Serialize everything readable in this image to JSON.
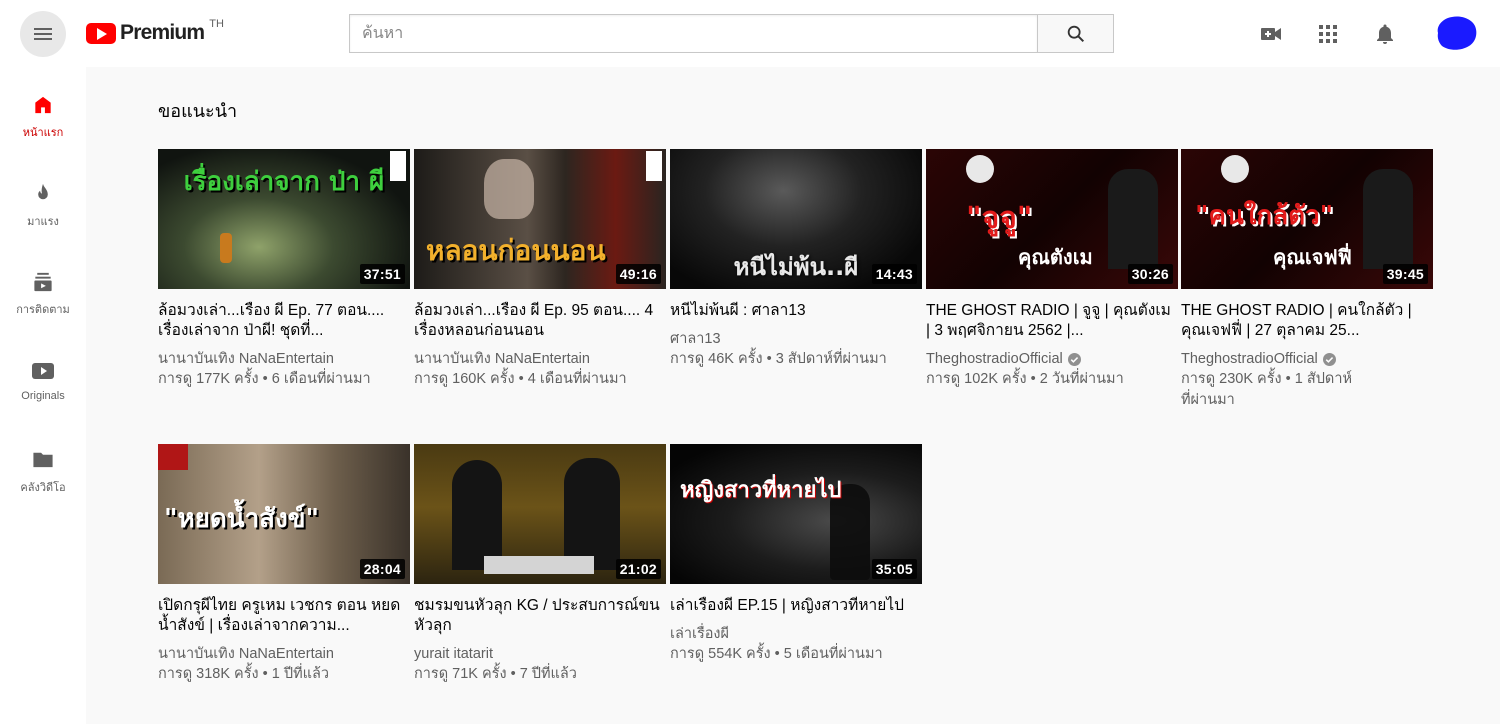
{
  "header": {
    "logo_text": "Premium",
    "country_code": "TH",
    "search_placeholder": "ค้นหา"
  },
  "sidebar": {
    "items": [
      {
        "label": "หน้าแรก",
        "icon": "home-icon",
        "active": true
      },
      {
        "label": "มาแรง",
        "icon": "fire-icon"
      },
      {
        "label": "การติดตาม",
        "icon": "subscriptions-icon"
      },
      {
        "label": "Originals",
        "icon": "play-box-icon"
      },
      {
        "label": "คลังวิดีโอ",
        "icon": "folder-icon"
      }
    ]
  },
  "section_title": "ขอแนะนำ",
  "videos": [
    {
      "title": "ล้อมวงเล่า...เรื่อง ผี Ep. 77 ตอน.... เรื่องเล่าจาก ป่าผี! ชุดที่...",
      "channel": "นานาบันเทิง NaNaEntertain",
      "views": "การดู 177K ครั้ง",
      "age": "6 เดือนที่ผ่านมา",
      "duration": "37:51",
      "thumb_text": "เรื่องเล่าจาก ป่า ผี",
      "verified": false
    },
    {
      "title": "ล้อมวงเล่า...เรื่อง ผี Ep. 95 ตอน.... 4 เรื่องหลอนก่อนนอน",
      "channel": "นานาบันเทิง NaNaEntertain",
      "views": "การดู 160K ครั้ง",
      "age": "4 เดือนที่ผ่านมา",
      "duration": "49:16",
      "thumb_text": "หลอนก่อนนอน",
      "verified": false
    },
    {
      "title": "หนีไม่พ้นผี : ศาลา13",
      "channel": "ศาลา13",
      "views": "การดู 46K ครั้ง",
      "age": "3 สัปดาห์ที่ผ่านมา",
      "duration": "14:43",
      "thumb_text": "หนีไม่พ้น..ผี",
      "verified": false
    },
    {
      "title": "THE GHOST RADIO | จูจู | คุณตังเม | 3 พฤศจิกายน 2562 |...",
      "channel": "TheghostradioOfficial",
      "views": "การดู 102K ครั้ง",
      "age": "2 วันที่ผ่านมา",
      "duration": "30:26",
      "thumb_text": "\"จูจู\"",
      "thumb_sub": "คุณตังเม",
      "verified": true
    },
    {
      "title": "THE GHOST RADIO | คนใกล้ตัว | คุณเจฟฟี่ | 27 ตุลาคม 25...",
      "channel": "TheghostradioOfficial",
      "views": "การดู 230K ครั้ง",
      "age": "1 สัปดาห์ที่ผ่านมา",
      "duration": "39:45",
      "thumb_text": "\"คนใกล้ตัว\"",
      "thumb_sub": "คุณเจฟฟี่",
      "verified": true
    },
    {
      "title": "เปิดกรุผีไทย ครูเหม เวชกร ตอน หยดน้ำสังข์ | เรื่องเล่าจากความ...",
      "channel": "นานาบันเทิง NaNaEntertain",
      "views": "การดู 318K ครั้ง",
      "age": "1 ปีที่แล้ว",
      "duration": "28:04",
      "thumb_text": "\"หยดน้ำสังข์\"",
      "verified": false
    },
    {
      "title": "ชมรมขนหัวลุก KG / ประสบการณ์ขนหัวลุก",
      "channel": "yurait itatarit",
      "views": "การดู 71K ครั้ง",
      "age": "7 ปีที่แล้ว",
      "duration": "21:02",
      "thumb_text": "",
      "verified": false
    },
    {
      "title": "เล่าเรื่องผี EP.15 | หญิงสาวที่หายไป",
      "channel": "เล่าเรื่องผี",
      "views": "การดู 554K ครั้ง",
      "age": "5 เดือนที่ผ่านมา",
      "duration": "35:05",
      "thumb_text": "หญิงสาวที่หายไป",
      "verified": false
    }
  ],
  "colors": {
    "brand_red": "#ff0000",
    "active_red": "#cc0000",
    "text_secondary": "#606060",
    "avatar_blue": "#1a1aff"
  }
}
